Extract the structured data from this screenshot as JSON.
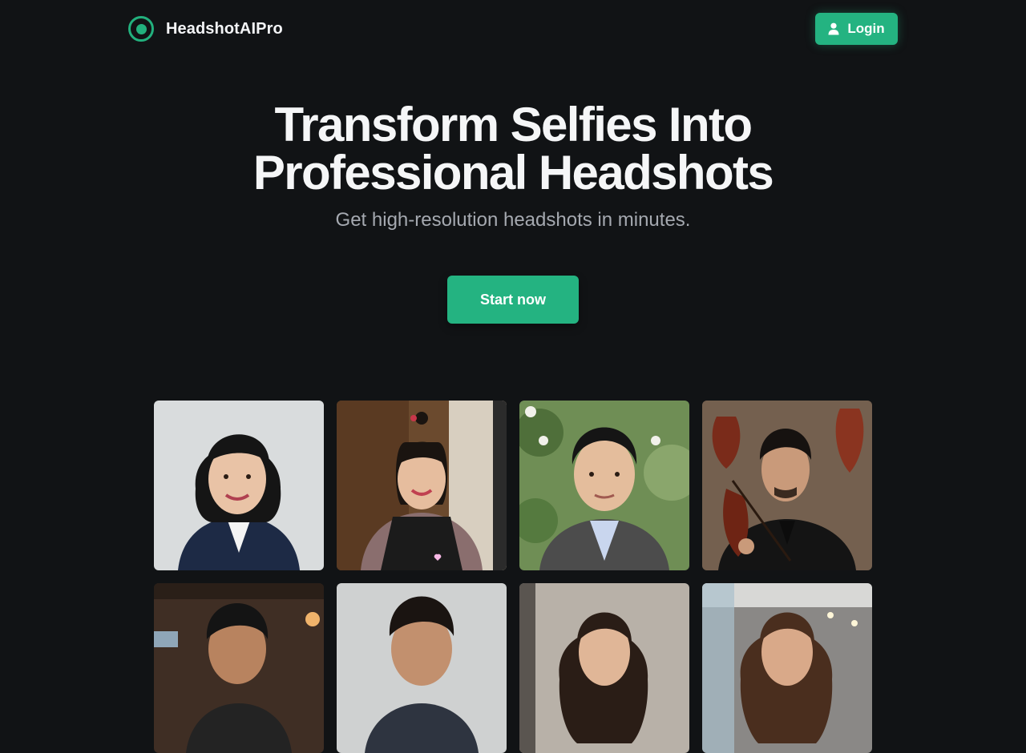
{
  "brand": {
    "name": "HeadshotAIPro"
  },
  "nav": {
    "login_label": "Login"
  },
  "hero": {
    "title_line1": "Transform Selfies Into",
    "title_line2": "Professional Headshots",
    "subtitle": "Get high-resolution headshots in minutes.",
    "cta_label": "Start now"
  },
  "colors": {
    "background": "#111315",
    "accent": "#24b381",
    "text_primary": "#f5f6f7",
    "text_secondary": "#a5a9b0"
  },
  "gallery": [
    {
      "name": "woman-navy-blazer-headshot"
    },
    {
      "name": "woman-apron-cafe-headshot"
    },
    {
      "name": "man-gray-blazer-garden-headshot"
    },
    {
      "name": "man-violin-black-suit-headshot"
    },
    {
      "name": "man-restaurant-headshot"
    },
    {
      "name": "man-studio-headshot"
    },
    {
      "name": "woman-indoor-headshot"
    },
    {
      "name": "woman-office-headshot"
    }
  ]
}
